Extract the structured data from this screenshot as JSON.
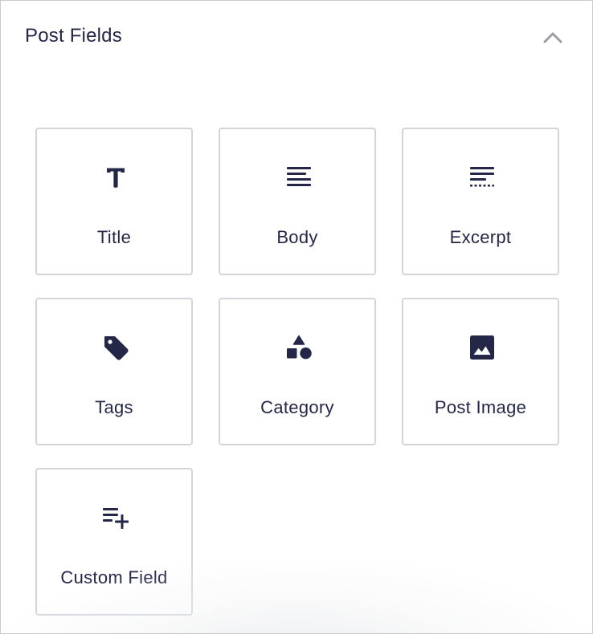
{
  "panel": {
    "title": "Post Fields",
    "toggle_icon": "chevron-up-icon"
  },
  "fields": [
    {
      "label": "Title",
      "icon": "title-icon"
    },
    {
      "label": "Body",
      "icon": "align-left-icon"
    },
    {
      "label": "Excerpt",
      "icon": "excerpt-icon"
    },
    {
      "label": "Tags",
      "icon": "tag-icon"
    },
    {
      "label": "Category",
      "icon": "shapes-icon"
    },
    {
      "label": "Post Image",
      "icon": "image-icon"
    },
    {
      "label": "Custom Field",
      "icon": "playlist-add-icon"
    }
  ],
  "colors": {
    "text": "#242748",
    "tile_border": "#d3d5da",
    "panel_border": "#c9cacd",
    "chevron": "#9a9ca6"
  }
}
